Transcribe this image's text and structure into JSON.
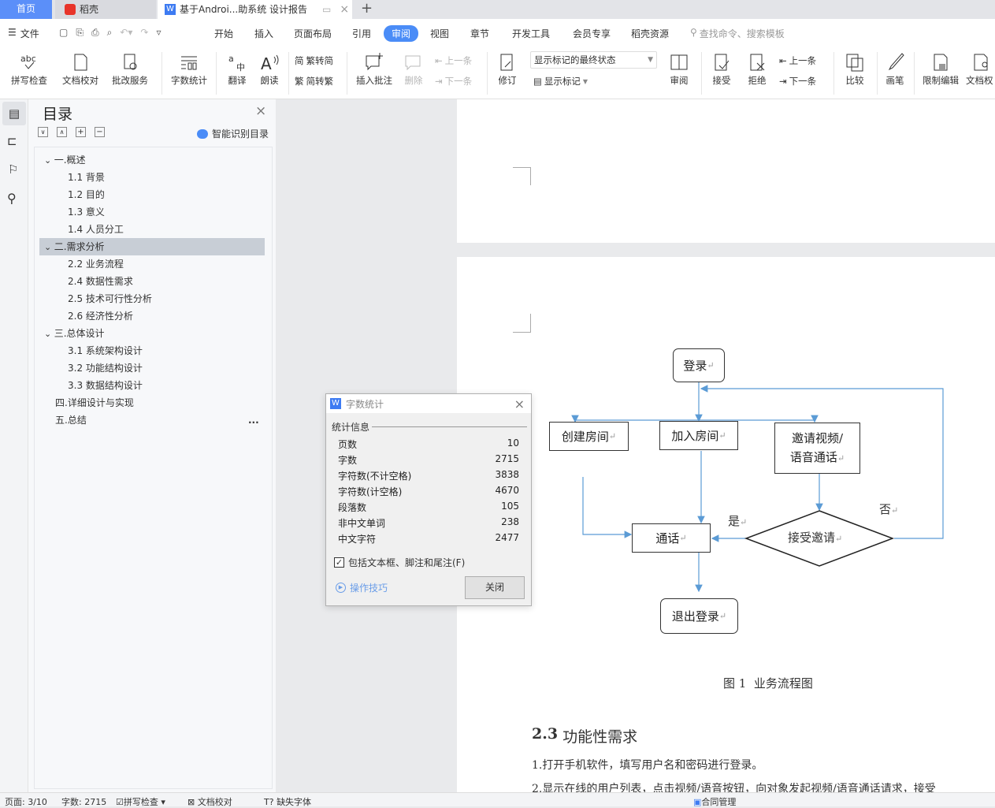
{
  "tabs": {
    "home": "首页",
    "daoke": "稻壳",
    "doc": "基于Androi...助系统 设计报告",
    "new_tab": "+"
  },
  "menu": {
    "file": "文件",
    "items": [
      "开始",
      "插入",
      "页面布局",
      "引用",
      "审阅",
      "视图",
      "章节",
      "开发工具",
      "会员专享",
      "稻壳资源"
    ],
    "active": "审阅",
    "search_placeholder": "查找命令、搜索模板"
  },
  "ribbon": {
    "spell": "拼写检查",
    "proof": "文档校对",
    "review_service": "批改服务",
    "word_count": "字数统计",
    "translate": "翻译",
    "read_aloud": "朗读",
    "trad_to_simp": "繁转简",
    "simp_to_trad": "简转繁",
    "insert_comment": "插入批注",
    "delete": "删除",
    "prev_comment": "上一条",
    "next_comment": "下一条",
    "revise": "修订",
    "markup_state": "显示标记的最终状态",
    "show_markup": "显示标记",
    "review": "审阅",
    "accept": "接受",
    "reject": "拒绝",
    "prev_change": "上一条",
    "next_change": "下一条",
    "compare": "比较",
    "pen": "画笔",
    "restrict_edit": "限制编辑",
    "doc_rights": "文档权"
  },
  "toc": {
    "title": "目录",
    "smart_recognize": "智能识别目录",
    "more": "...",
    "items": [
      {
        "label": "一.概述",
        "level": 1,
        "expanded": true
      },
      {
        "label": "1.1 背景",
        "level": 2
      },
      {
        "label": "1.2 目的",
        "level": 2
      },
      {
        "label": "1.3 意义",
        "level": 2
      },
      {
        "label": "1.4 人员分工",
        "level": 2
      },
      {
        "label": "二.需求分析",
        "level": 1,
        "expanded": true,
        "selected": true
      },
      {
        "label": "2.2 业务流程",
        "level": 2
      },
      {
        "label": "2.4 数据性需求",
        "level": 2
      },
      {
        "label": "2.5 技术可行性分析",
        "level": 2
      },
      {
        "label": "2.6 经济性分析",
        "level": 2
      },
      {
        "label": "三.总体设计",
        "level": 1,
        "expanded": true
      },
      {
        "label": "3.1 系统架构设计",
        "level": 2
      },
      {
        "label": "3.2 功能结构设计",
        "level": 2
      },
      {
        "label": "3.3 数据结构设计",
        "level": 2
      },
      {
        "label": "四.详细设计与实现",
        "level": 1
      },
      {
        "label": "五.总结",
        "level": 1
      }
    ]
  },
  "flowchart": {
    "login": "登录",
    "create_room": "创建房间",
    "join_room": "加入房间",
    "invite_line1": "邀请视频/",
    "invite_line2": "语音通话",
    "call": "通话",
    "accept_invite": "接受邀请",
    "yes": "是",
    "no": "否",
    "logout": "退出登录",
    "return_mark": "↵"
  },
  "document": {
    "caption": "图 1  业务流程图",
    "heading_num": "2.3",
    "heading_text": "功能性需求",
    "para1": "1.打开手机软件，填写用户名和密码进行登录。",
    "para2": "2.显示在线的用户列表，点击视频/语音按钮，向对象发起视频/语音通话请求，接受"
  },
  "dialog": {
    "title": "字数统计",
    "section": "统计信息",
    "rows": [
      {
        "label": "页数",
        "value": "10"
      },
      {
        "label": "字数",
        "value": "2715"
      },
      {
        "label": "字符数(不计空格)",
        "value": "3838"
      },
      {
        "label": "字符数(计空格)",
        "value": "4670"
      },
      {
        "label": "段落数",
        "value": "105"
      },
      {
        "label": "非中文单词",
        "value": "238"
      },
      {
        "label": "中文字符",
        "value": "2477"
      }
    ],
    "include_label": "包括文本框、脚注和尾注(F)",
    "include_checked": true,
    "tips": "操作技巧",
    "close": "关闭"
  },
  "status": {
    "page": "页面: 3/10",
    "words": "字数: 2715",
    "spell": "拼写检查",
    "proof": "文档校对",
    "missing_font": "缺失字体",
    "contract": "合同管理"
  },
  "colors": {
    "accent": "#4a8cf7",
    "flow_line": "#5b9bd5",
    "toc_selected": "#c8ced6"
  }
}
